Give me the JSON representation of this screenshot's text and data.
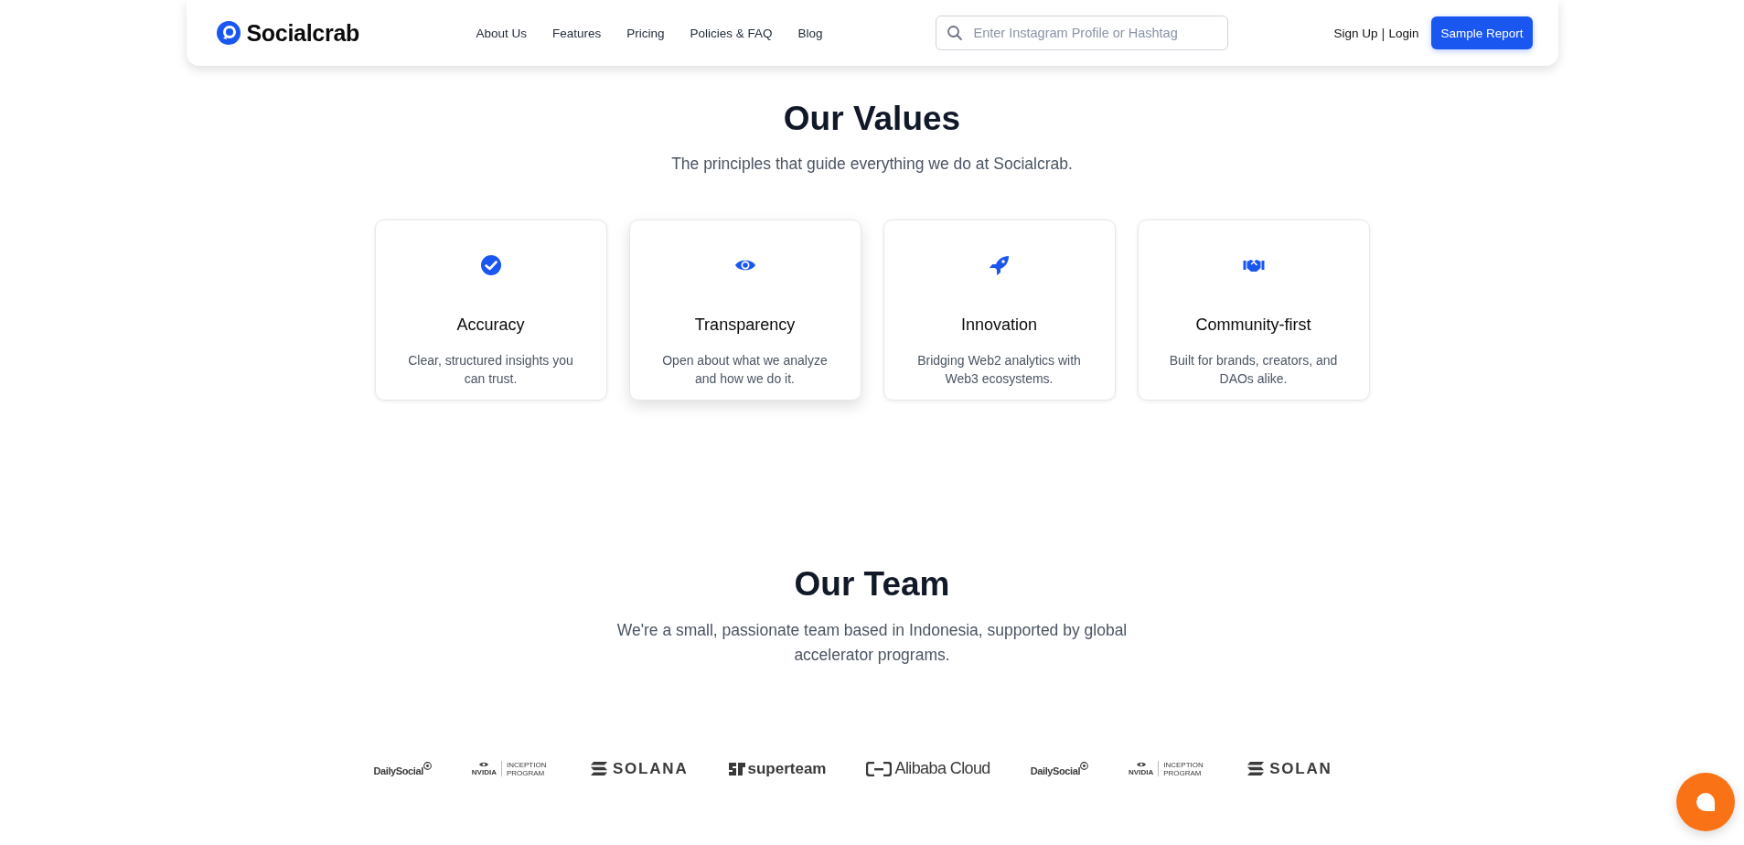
{
  "header": {
    "brand": "Socialcrab",
    "nav": [
      "About Us",
      "Features",
      "Pricing",
      "Policies & FAQ",
      "Blog"
    ],
    "search": {
      "placeholder": "Enter Instagram Profile or Hashtag"
    },
    "sign_up": "Sign Up",
    "separator": "|",
    "login": "Login",
    "cta": "Sample Report"
  },
  "values": {
    "title": "Our Values",
    "subtitle": "The principles that guide everything we do at Socialcrab.",
    "cards": [
      {
        "kind": "check",
        "title": "Accuracy",
        "text": "Clear, structured insights you can trust.",
        "hovered": false
      },
      {
        "kind": "eye",
        "title": "Transparency",
        "text": "Open about what we analyze and how we do it.",
        "hovered": true
      },
      {
        "kind": "rocket",
        "title": "Innovation",
        "text": "Bridging Web2 analytics with Web3 ecosystems.",
        "hovered": false
      },
      {
        "kind": "handshake",
        "title": "Community-first",
        "text": "Built for brands, creators, and DAOs alike.",
        "hovered": false
      }
    ]
  },
  "team": {
    "title": "Our Team",
    "subtitle": "We're a small, passionate team based in Indonesia, supported by global accelerator programs.",
    "partners": [
      {
        "kind": "dailysocial",
        "text": "DailySocial"
      },
      {
        "kind": "nvidia",
        "text": "NVIDIA",
        "subtext": "INCEPTION PROGRAM"
      },
      {
        "kind": "solana",
        "text": "SOLANA"
      },
      {
        "kind": "superteam",
        "text": "superteam"
      },
      {
        "kind": "alibaba",
        "text": "Alibaba Cloud"
      },
      {
        "kind": "dailysocial",
        "text": "DailySocial"
      },
      {
        "kind": "nvidia",
        "text": "NVIDIA",
        "subtext": "INCEPTION PROGRAM"
      },
      {
        "kind": "solana",
        "text": "SOLAN"
      }
    ]
  }
}
